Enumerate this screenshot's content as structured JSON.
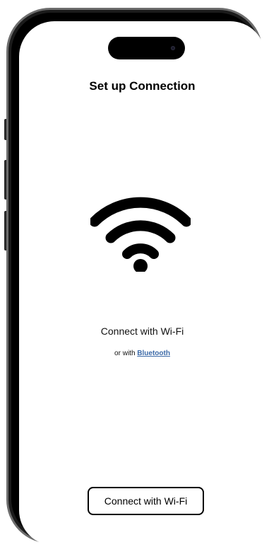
{
  "screen": {
    "title": "Set up Connection",
    "main_label": "Connect with Wi-Fi",
    "alt_prefix": "or with ",
    "alt_link": "Bluetooth",
    "primary_button": "Connect with Wi-Fi"
  },
  "icons": {
    "hero": "wifi-icon",
    "camera": "camera-icon"
  },
  "colors": {
    "background": "#ffffff",
    "text": "#000000",
    "link": "#3c6aa8",
    "frame": "#1b1b1b"
  }
}
